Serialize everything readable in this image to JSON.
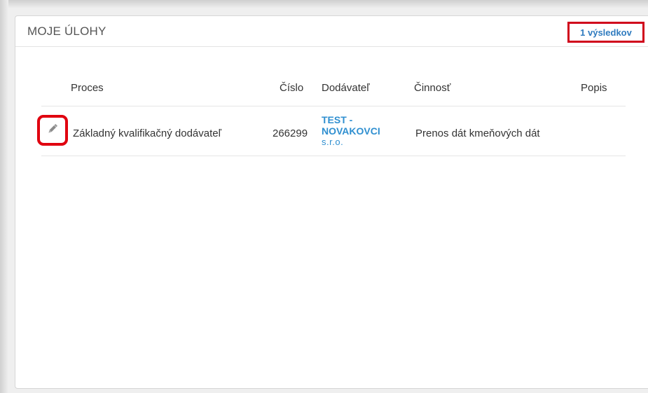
{
  "panel": {
    "title": "MOJE ÚLOHY",
    "results_label": "1 výsledkov"
  },
  "table": {
    "columns": [
      "Proces",
      "Číslo",
      "Dodávateľ",
      "Činnosť",
      "Popis"
    ],
    "rows": [
      {
        "process": "Základný kvalifikačný dodávateľ",
        "number": "266299",
        "supplier_line1": "TEST -",
        "supplier_line2": "NOVAKOVCI",
        "supplier_line3": "s.r.o.",
        "activity": "Prenos dát kmeňových dát",
        "description": ""
      }
    ]
  },
  "icons": {
    "edit": "pencil-icon"
  },
  "colors": {
    "highlight": "#d0021b",
    "link": "#2f8fd0"
  }
}
